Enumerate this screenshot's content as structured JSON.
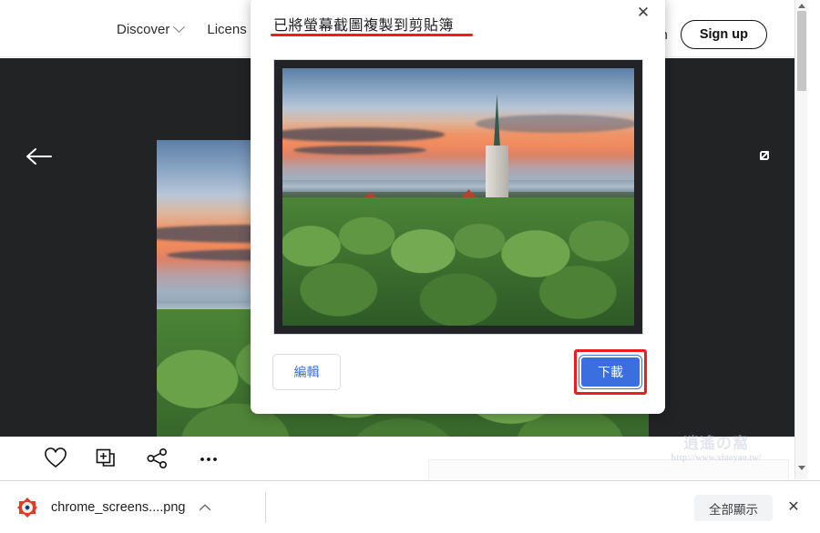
{
  "header": {
    "nav_left": [
      {
        "label": "Discover",
        "icon": "chevron-down-icon"
      },
      {
        "label": "Licens"
      }
    ],
    "nav_right": {
      "login_label": "in",
      "signup_label": "Sign up"
    }
  },
  "viewer": {
    "back_icon": "back-arrow-icon",
    "expand_icon": "expand-icon",
    "actions": [
      {
        "name": "like-icon"
      },
      {
        "name": "add-to-collection-icon"
      },
      {
        "name": "share-icon"
      },
      {
        "name": "more-options-icon"
      }
    ]
  },
  "watermark": {
    "logo": "逍遙の窩",
    "url": "http://www.xiaoyao.tw/"
  },
  "dialog": {
    "title": "已將螢幕截圖複製到剪貼簿",
    "close_icon": "close-icon",
    "edit_label": "編輯",
    "download_label": "下載",
    "annotation_color": "#f01c1c",
    "download_button_color": "#3b6fe0",
    "preview_alt": "Tallinn old town at sunset screenshot preview"
  },
  "download_bar": {
    "file_name": "chrome_screens....png",
    "file_icon": "image-file-icon",
    "expand_icon": "chevron-up-icon",
    "show_all_label": "全部顯示",
    "close_icon": "close-icon"
  },
  "scrollbar": {
    "up_icon": "scroll-up-arrow-icon",
    "down_icon": "scroll-down-arrow-icon",
    "thumb": "scrollbar-thumb"
  }
}
